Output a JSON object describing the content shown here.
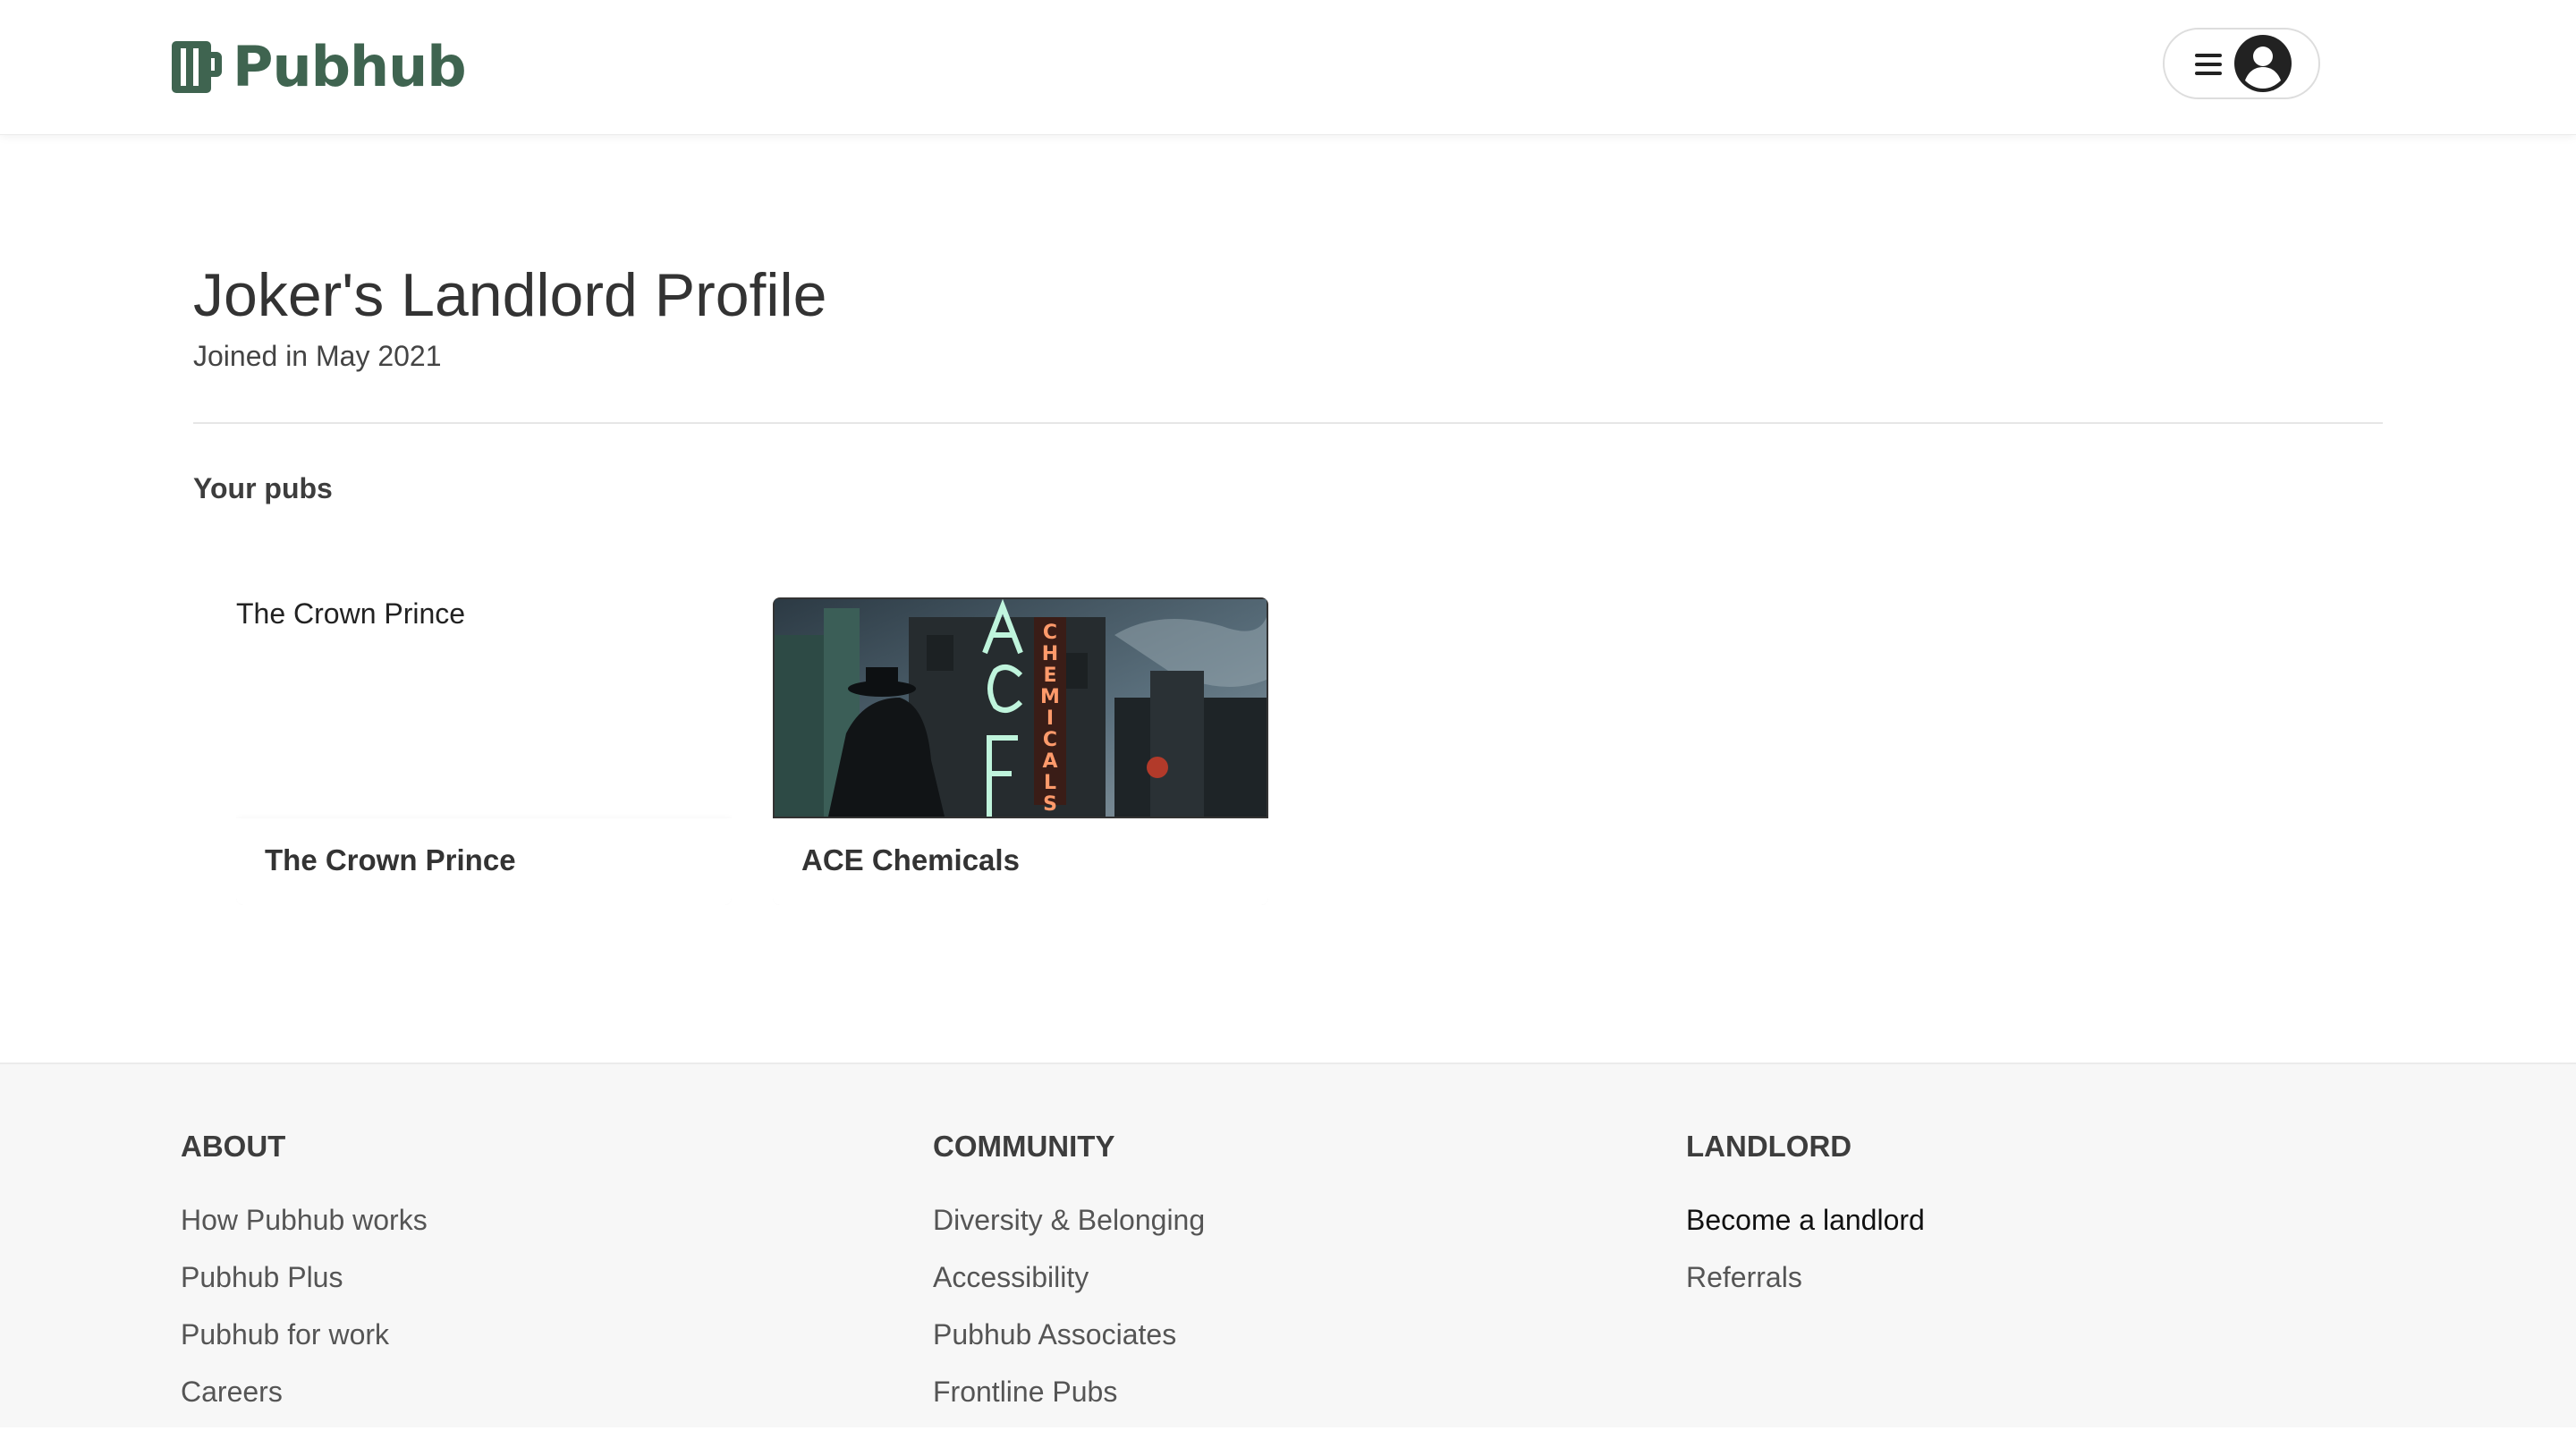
{
  "header": {
    "logo_text": "Pubhub",
    "brand_color": "#3f6450"
  },
  "profile": {
    "title": "Joker's Landlord Profile",
    "joined": "Joined in May 2021"
  },
  "pubs": {
    "section_title": "Your pubs",
    "items": [
      {
        "name": "The Crown Prince",
        "image_alt": "The Crown Prince",
        "image_loaded": false
      },
      {
        "name": "ACE Chemicals",
        "image_loaded": true,
        "image_sign_letters": "ACE",
        "image_vertical_sign": "CHEMICALS"
      }
    ]
  },
  "footer": {
    "about": {
      "heading": "ABOUT",
      "links": [
        "How Pubhub works",
        "Pubhub Plus",
        "Pubhub for work",
        "Careers"
      ]
    },
    "community": {
      "heading": "COMMUNITY",
      "links": [
        "Diversity & Belonging",
        "Accessibility",
        "Pubhub Associates",
        "Frontline Pubs"
      ]
    },
    "landlord": {
      "heading": "LANDLORD",
      "links": [
        "Become a landlord",
        "Referrals"
      ]
    }
  }
}
